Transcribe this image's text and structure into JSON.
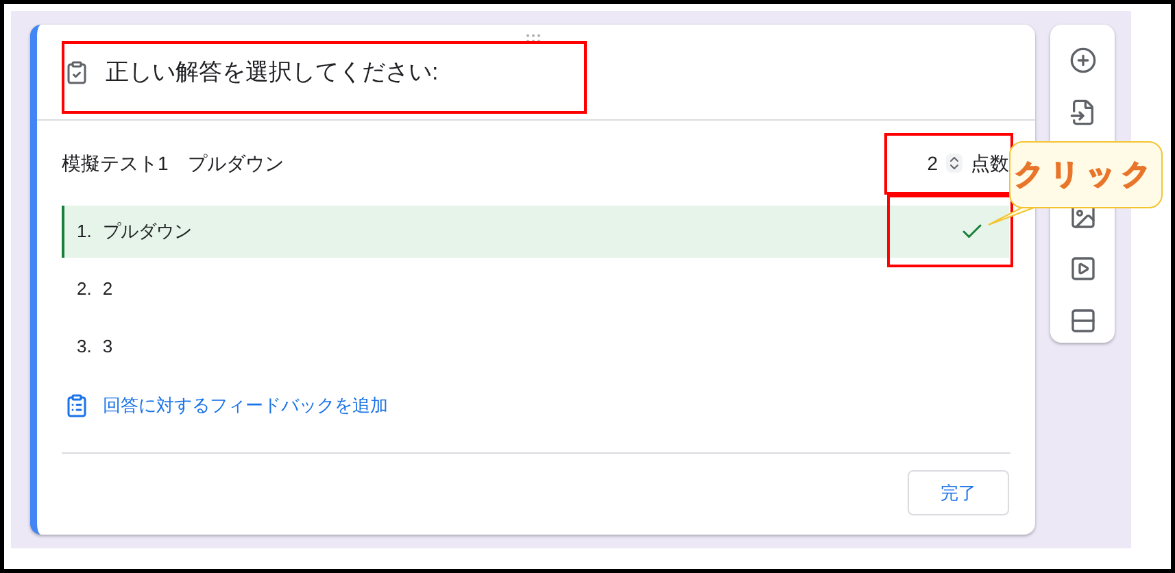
{
  "question": {
    "title": "正しい解答を選択してください:",
    "label": "模擬テスト1　プルダウン",
    "points": "2",
    "points_label": "点数"
  },
  "options": [
    {
      "number": "1.",
      "text": "プルダウン",
      "correct": true
    },
    {
      "number": "2.",
      "text": "2",
      "correct": false
    },
    {
      "number": "3.",
      "text": "3",
      "correct": false
    }
  ],
  "feedback_link": "回答に対するフィードバックを追加",
  "done_button": "完了",
  "toolbar": [
    {
      "kind": "add"
    },
    {
      "kind": "import"
    },
    {
      "kind": "image"
    },
    {
      "kind": "video"
    },
    {
      "kind": "section"
    }
  ],
  "callout": "クリック"
}
